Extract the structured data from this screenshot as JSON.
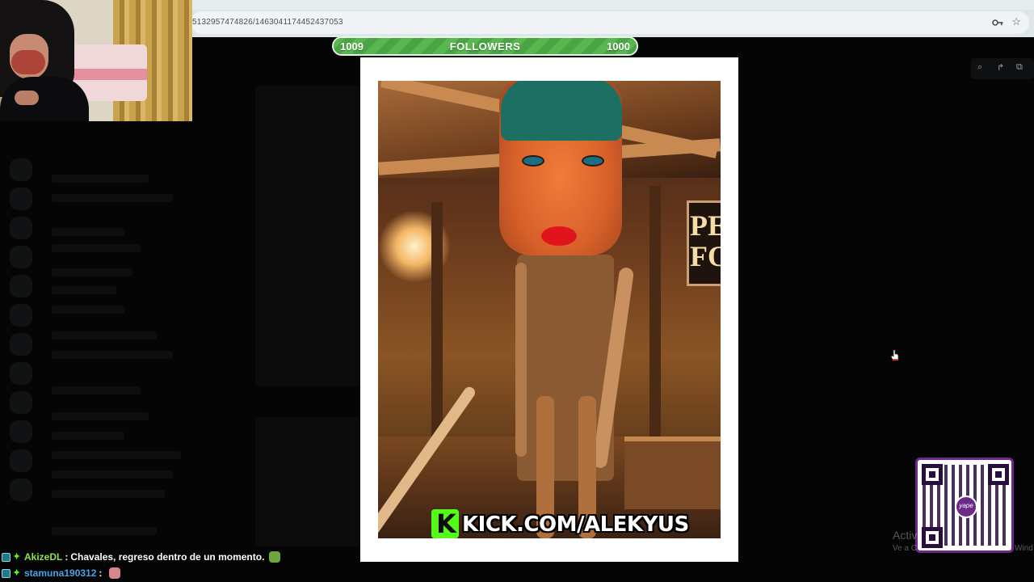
{
  "browser": {
    "url": "5132957474826/1463041174452437053",
    "star_icon": "star-icon",
    "key_icon": "key-icon"
  },
  "followers_goal": {
    "current": "1009",
    "label": "FOLLOWERS",
    "goal": "1000",
    "progress_fraction": 1.0,
    "colors": {
      "fill": "#58b84f",
      "track": "#2f7d32",
      "text": "#ffffff"
    }
  },
  "artwork": {
    "sign_text": "PE\nFO",
    "watermark_logo": "K",
    "watermark_text": "KICK.COM/ALEKYUS",
    "brand_color": "#53fc18"
  },
  "toolbar": {
    "zoom_icon": "zoom-icon",
    "share_icon": "share-icon",
    "open_icon": "open-external-icon",
    "zoom_glyph": "⌕",
    "share_glyph": "↱",
    "open_glyph": "⧉"
  },
  "qr_widget": {
    "logo_text": "yape",
    "top_tag": "",
    "border_color": "#6b2a8a"
  },
  "windows_watermark": {
    "title": "Activ",
    "subtitle": "Ve a C",
    "subtitle_right": "Wind"
  },
  "chat": {
    "messages": [
      {
        "user": "AkizeDL",
        "separator": ":",
        "text": "Chavales, regreso dentro de un momento.",
        "user_color": "#8fe04a",
        "emote_color": "#6fa83a"
      },
      {
        "user": "stamuna190312",
        "separator": ":",
        "text": "",
        "user_color": "#4aa3e8",
        "emote_color": "#d9868a"
      }
    ]
  }
}
